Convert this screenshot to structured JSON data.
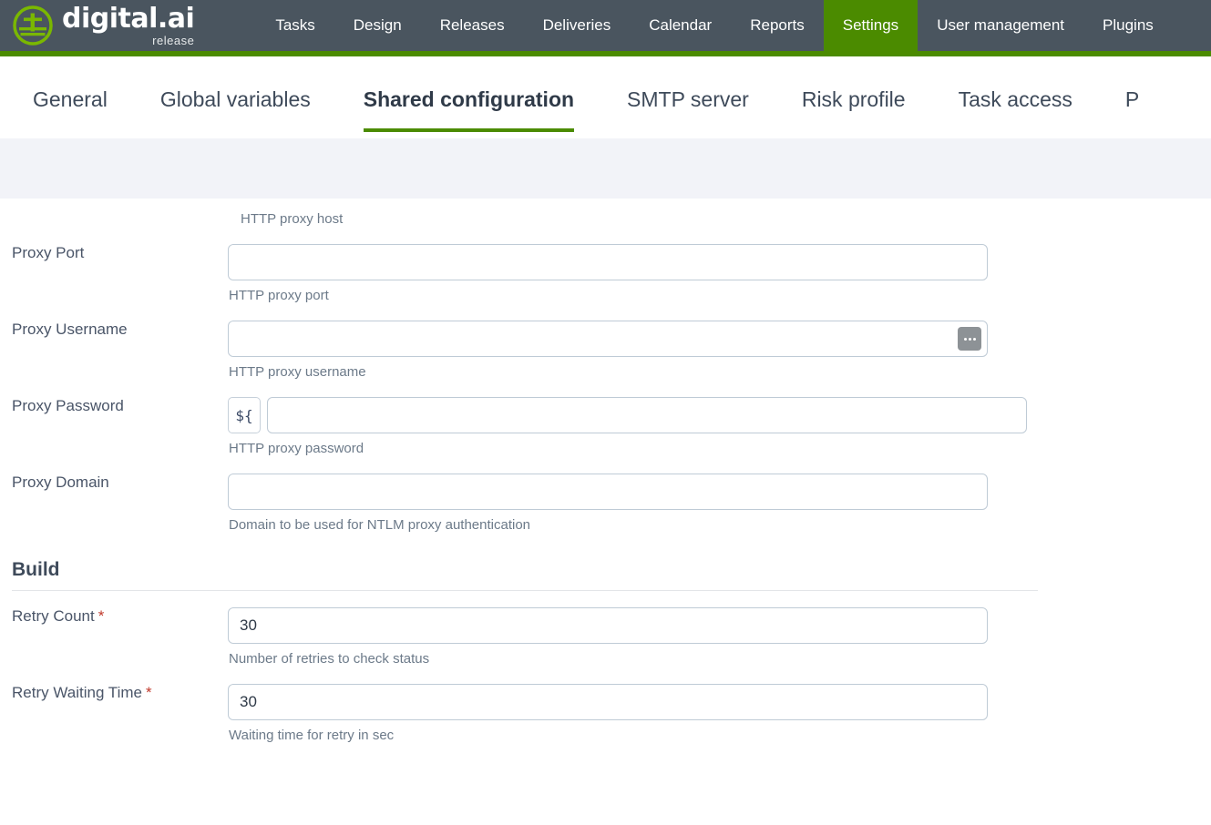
{
  "brand": {
    "name": "digital.ai",
    "sub": "release",
    "logo_icon": "digitalai-logo-icon",
    "accent_green": "#4b8b00",
    "nav_background": "#4a555f"
  },
  "topnav": {
    "items": [
      {
        "label": "Tasks",
        "active": false
      },
      {
        "label": "Design",
        "active": false
      },
      {
        "label": "Releases",
        "active": false
      },
      {
        "label": "Deliveries",
        "active": false
      },
      {
        "label": "Calendar",
        "active": false
      },
      {
        "label": "Reports",
        "active": false
      },
      {
        "label": "Settings",
        "active": true
      },
      {
        "label": "User management",
        "active": false
      },
      {
        "label": "Plugins",
        "active": false
      }
    ]
  },
  "subnav": {
    "items": [
      {
        "label": "General",
        "active": false
      },
      {
        "label": "Global variables",
        "active": false
      },
      {
        "label": "Shared configuration",
        "active": true
      },
      {
        "label": "SMTP server",
        "active": false
      },
      {
        "label": "Risk profile",
        "active": false
      },
      {
        "label": "Task access",
        "active": false
      },
      {
        "label": "P",
        "active": false
      }
    ]
  },
  "form": {
    "top_partial_help": "HTTP proxy host",
    "fields": [
      {
        "label": "Proxy Port",
        "required": false,
        "value": "",
        "placeholder": "",
        "help": "HTTP proxy port",
        "has_variable_button": false,
        "variable_button_label": "",
        "has_ellipsis_button": false
      },
      {
        "label": "Proxy Username",
        "required": false,
        "value": "",
        "placeholder": "",
        "help": "HTTP proxy username",
        "has_variable_button": false,
        "variable_button_label": "",
        "has_ellipsis_button": true
      },
      {
        "label": "Proxy Password",
        "required": false,
        "value": "",
        "placeholder": "",
        "help": "HTTP proxy password",
        "has_variable_button": true,
        "variable_button_label": "${",
        "has_ellipsis_button": false
      },
      {
        "label": "Proxy Domain",
        "required": false,
        "value": "",
        "placeholder": "",
        "help": "Domain to be used for NTLM proxy authentication",
        "has_variable_button": false,
        "variable_button_label": "",
        "has_ellipsis_button": false
      }
    ],
    "section": {
      "title": "Build"
    },
    "build_fields": [
      {
        "label": "Retry Count",
        "required": true,
        "required_marker": "*",
        "value": "30",
        "placeholder": "",
        "help": "Number of retries to check status",
        "has_variable_button": false,
        "variable_button_label": "",
        "has_ellipsis_button": false
      },
      {
        "label": "Retry Waiting Time",
        "required": true,
        "required_marker": "*",
        "value": "30",
        "placeholder": "",
        "help": "Waiting time for retry in sec",
        "has_variable_button": false,
        "variable_button_label": "",
        "has_ellipsis_button": false
      }
    ]
  }
}
